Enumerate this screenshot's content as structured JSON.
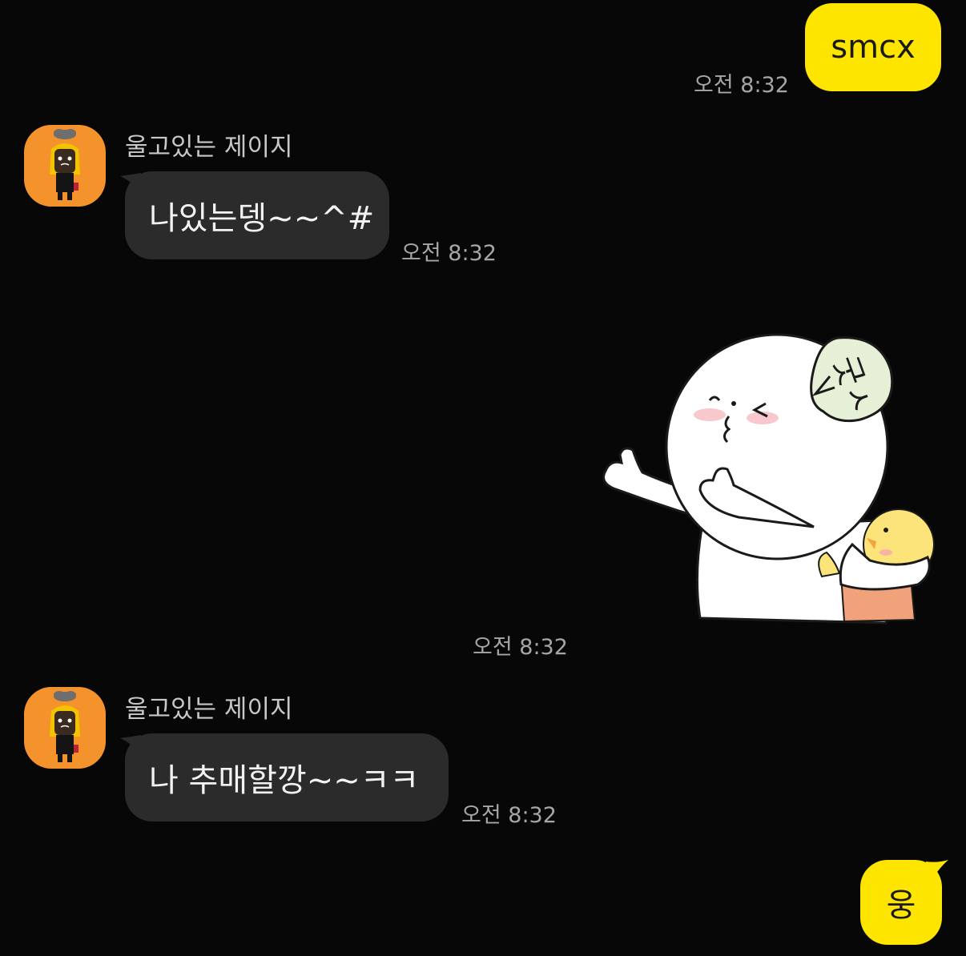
{
  "messages": [
    {
      "side": "out",
      "text": "smcx",
      "time": "오전 8:32"
    },
    {
      "side": "in",
      "sender": "울고있는 제이지",
      "text": "나있는뎅~~^#",
      "time": "오전 8:32"
    },
    {
      "side": "in",
      "type": "sticker",
      "sticker_text": "굿ㅅ",
      "time": "오전 8:32"
    },
    {
      "side": "in",
      "sender": "울고있는 제이지",
      "text": "나 추매할깡~~ㅋㅋ",
      "time": "오전 8:32"
    },
    {
      "side": "out",
      "text": "웅"
    }
  ],
  "colors": {
    "background": "#070707",
    "outgoing_bubble": "#fee500",
    "incoming_bubble": "#2b2b2b",
    "avatar": "#f4932b"
  }
}
